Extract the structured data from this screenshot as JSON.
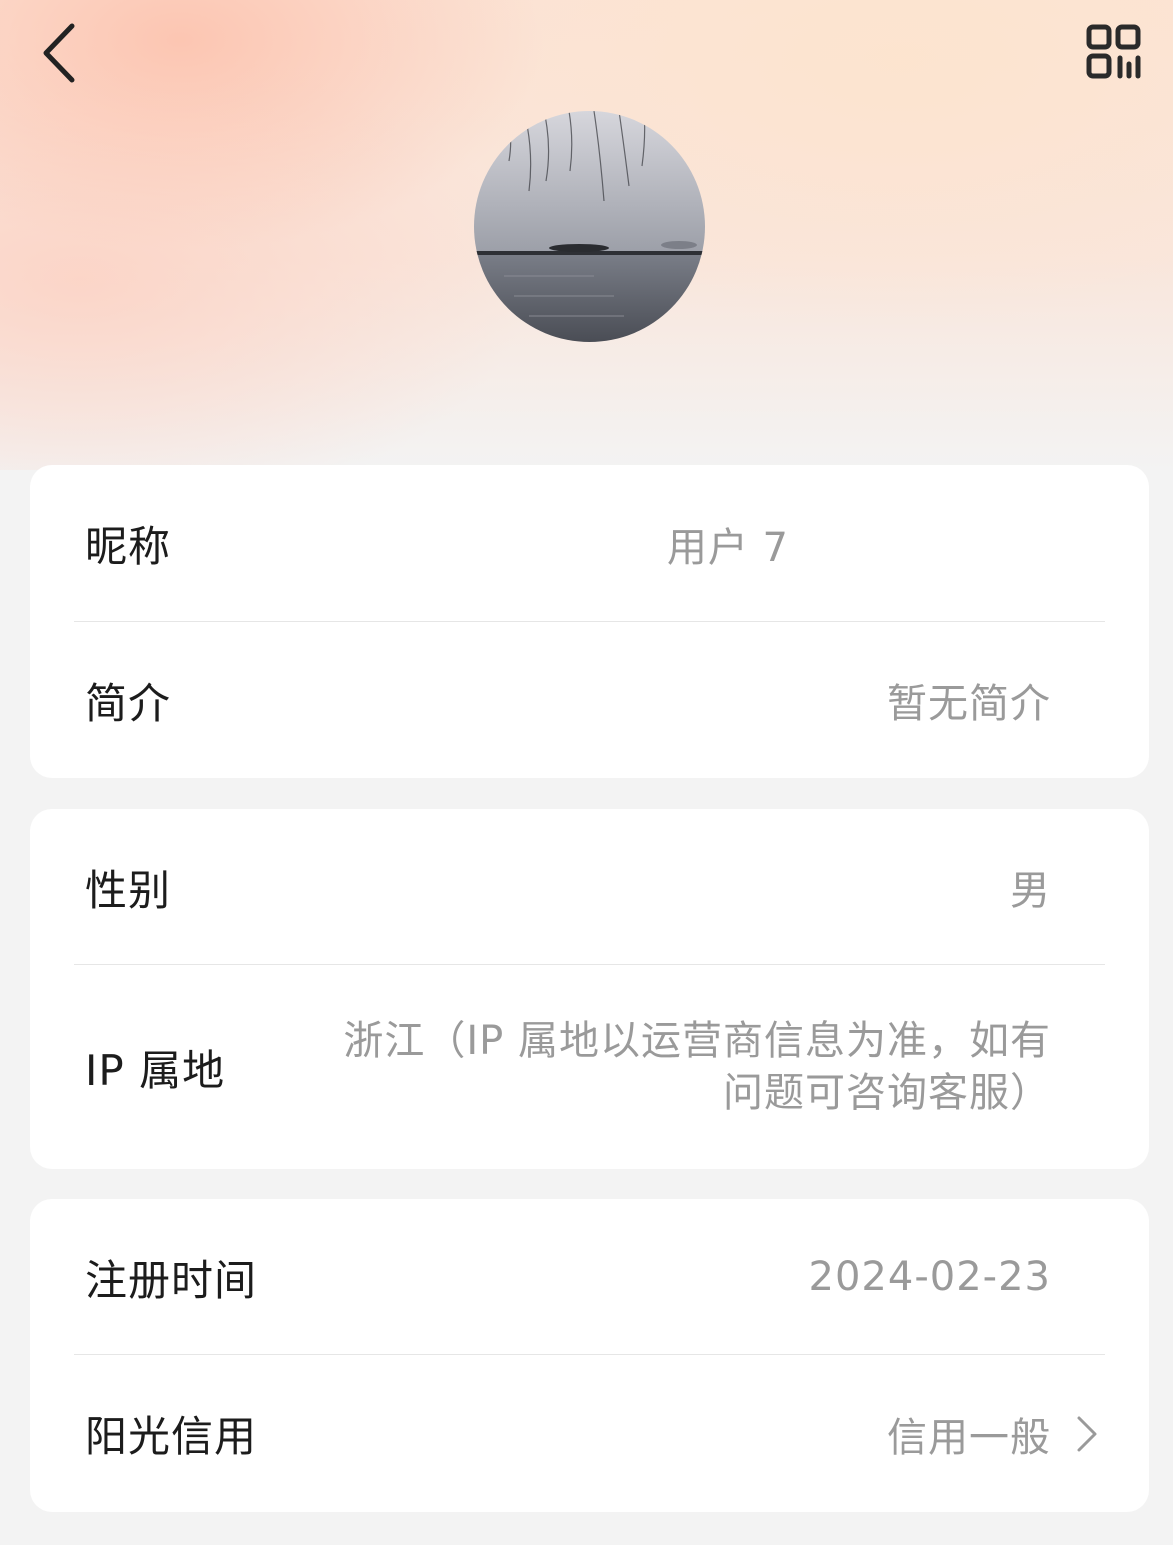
{
  "header": {
    "back_icon": "chevron-left-icon",
    "qr_icon": "qr-code-icon"
  },
  "profile": {
    "avatar_description": "lake-with-willow-branches"
  },
  "card_basic": {
    "nickname_label": "昵称",
    "nickname_value": "用户 7",
    "bio_label": "简介",
    "bio_value": "暂无简介"
  },
  "card_info": {
    "gender_label": "性别",
    "gender_value": "男",
    "ip_label": "IP 属地",
    "ip_value_line1": "浙江（IP 属地以运营商信息为准，如有",
    "ip_value_line2": "问题可咨询客服）"
  },
  "card_account": {
    "register_label": "注册时间",
    "register_value": "2024-02-23",
    "credit_label": "阳光信用",
    "credit_value": "信用一般"
  },
  "colors": {
    "label_text": "#1c1c1c",
    "value_text": "#9a9a9a",
    "card_bg": "#ffffff",
    "page_bg": "#f3f3f3"
  }
}
